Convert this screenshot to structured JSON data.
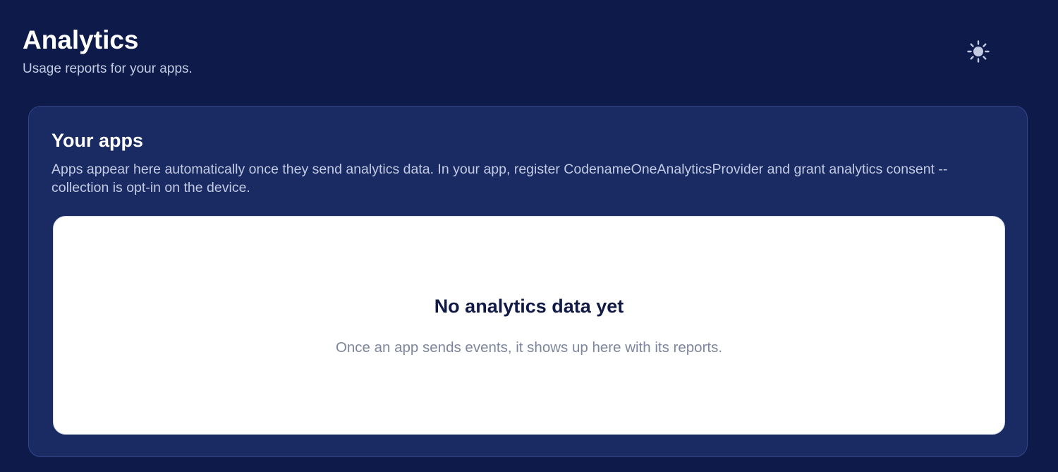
{
  "header": {
    "title": "Analytics",
    "subtitle": "Usage reports for your apps."
  },
  "theme_toggle": {
    "icon": "sun-icon",
    "color": "#c3cbe3"
  },
  "apps_card": {
    "title": "Your apps",
    "description": "Apps appear here automatically once they send analytics data. In your app, register CodenameOneAnalyticsProvider and grant analytics consent -- collection is opt-in on the device.",
    "empty_state": {
      "title": "No analytics data yet",
      "message": "Once an app sends events, it shows up here with its reports."
    }
  },
  "colors": {
    "background": "#0e1a4a",
    "card": "#1a2a63",
    "panel": "#ffffff"
  }
}
